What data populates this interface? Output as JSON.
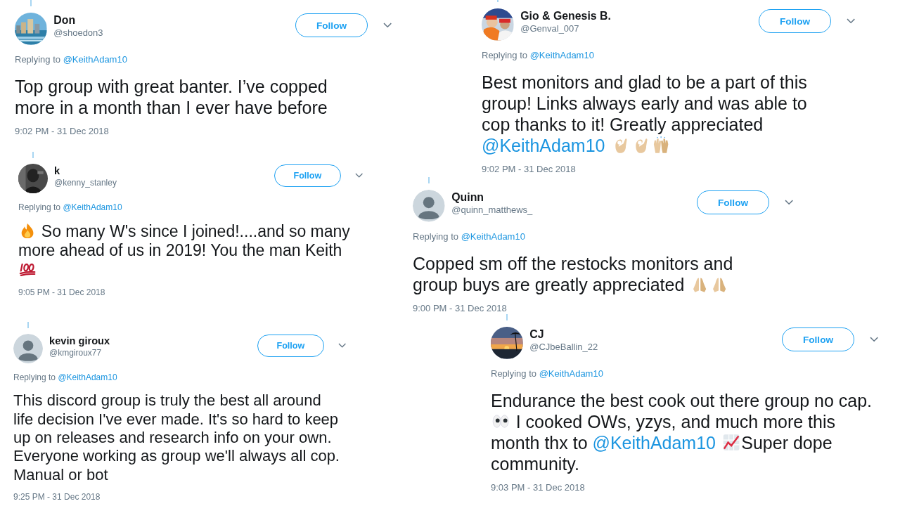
{
  "tweets": [
    {
      "name": "Don",
      "handle": "@shoedon3",
      "avatar": {
        "kind": "picture"
      },
      "follow": "Follow",
      "reply_label": "Replying to",
      "reply_to": "@KeithAdam10",
      "body": [
        {
          "kind": "text",
          "text": "Top group with great banter. I’ve copped more in a month than I ever have before"
        }
      ],
      "time": "9:02 PM - 31 Dec 2018"
    },
    {
      "name": "k",
      "handle": "@kenny_stanley",
      "avatar": {
        "kind": "picture"
      },
      "follow": "Follow",
      "reply_label": "Replying to",
      "reply_to": "@KeithAdam10",
      "body": [
        {
          "kind": "fire"
        },
        {
          "kind": "text",
          "text": " So many W's since I joined!....and so many more ahead of us in 2019! You the man Keith "
        },
        {
          "kind": "hundred"
        }
      ],
      "time": "9:05 PM - 31 Dec 2018"
    },
    {
      "name": "kevin giroux",
      "handle": "@kmgiroux77",
      "avatar": {
        "kind": "default"
      },
      "follow": "Follow",
      "reply_label": "Replying to",
      "reply_to": "@KeithAdam10",
      "body": [
        {
          "kind": "text",
          "text": "This discord group is truly the best all around life decision I've ever made. It's so hard to keep up on releases and research info on your own. Everyone working as group we'll always all cop. Manual or bot"
        }
      ],
      "time": "9:25 PM - 31 Dec 2018"
    },
    {
      "name": "Gio & Genesis B.",
      "handle": "@Genval_007",
      "avatar": {
        "kind": "picture"
      },
      "follow": "Follow",
      "reply_label": "Replying to",
      "reply_to": "@KeithAdam10",
      "body": [
        {
          "kind": "text",
          "text": "Best monitors and glad to be a part of this group! Links always early and was able to cop thanks to it! Greatly appreciated "
        },
        {
          "kind": "mention",
          "text": "@KeithAdam10"
        },
        {
          "kind": "okhand"
        },
        {
          "kind": "okhand"
        },
        {
          "kind": "raisedhands"
        }
      ],
      "time": "9:02 PM - 31 Dec 2018"
    },
    {
      "name": "Quinn",
      "handle": "@quinn_matthews_",
      "avatar": {
        "kind": "default"
      },
      "follow": "Follow",
      "reply_label": "Replying to",
      "reply_to": "@KeithAdam10",
      "body": [
        {
          "kind": "text",
          "text": "Copped sm off the restocks monitors and group buys are greatly appreciated "
        },
        {
          "kind": "pray"
        },
        {
          "kind": "pray"
        }
      ],
      "time": "9:00 PM - 31 Dec 2018"
    },
    {
      "name": "CJ",
      "handle": "@CJbeBallin_22",
      "avatar": {
        "kind": "picture"
      },
      "follow": "Follow",
      "reply_label": "Replying to",
      "reply_to": "@KeithAdam10",
      "body": [
        {
          "kind": "text",
          "text": "Endurance the best cook out there group no cap. "
        },
        {
          "kind": "eyes"
        },
        {
          "kind": "text",
          "text": " I cooked OWs, yzys, and much more this month thx to "
        },
        {
          "kind": "mention",
          "text": "@KeithAdam10"
        },
        {
          "kind": "chart"
        },
        {
          "kind": "text",
          "text": "Super dope community."
        }
      ],
      "time": "9:03 PM - 31 Dec 2018"
    }
  ]
}
